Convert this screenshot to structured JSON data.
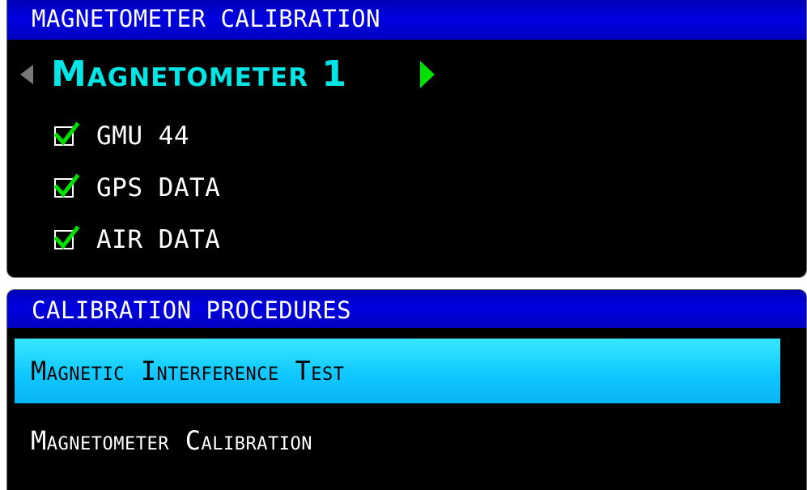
{
  "magnetometer_panel": {
    "title": "MAGNETOMETER CALIBRATION",
    "selector": {
      "label": "Magnetometer 1"
    },
    "checklist": [
      {
        "label": "GMU 44",
        "checked": true
      },
      {
        "label": "GPS DATA",
        "checked": true
      },
      {
        "label": "AIR DATA",
        "checked": true
      }
    ]
  },
  "procedures_panel": {
    "title": "CALIBRATION PROCEDURES",
    "items": [
      {
        "label": "Magnetic Interference Test",
        "selected": true
      },
      {
        "label": "Magnetometer Calibration",
        "selected": false
      }
    ]
  },
  "colors": {
    "title_bar": "#0000e0",
    "selector_text": "#00e6e6",
    "right_arrow": "#00e000",
    "left_arrow_disabled": "#7a7a7a",
    "check_mark": "#00e000",
    "selected_item_bg": "#10c8ff"
  },
  "icons": {
    "left_arrow": "triangle-left-icon",
    "right_arrow": "triangle-right-icon",
    "check": "check-icon"
  }
}
